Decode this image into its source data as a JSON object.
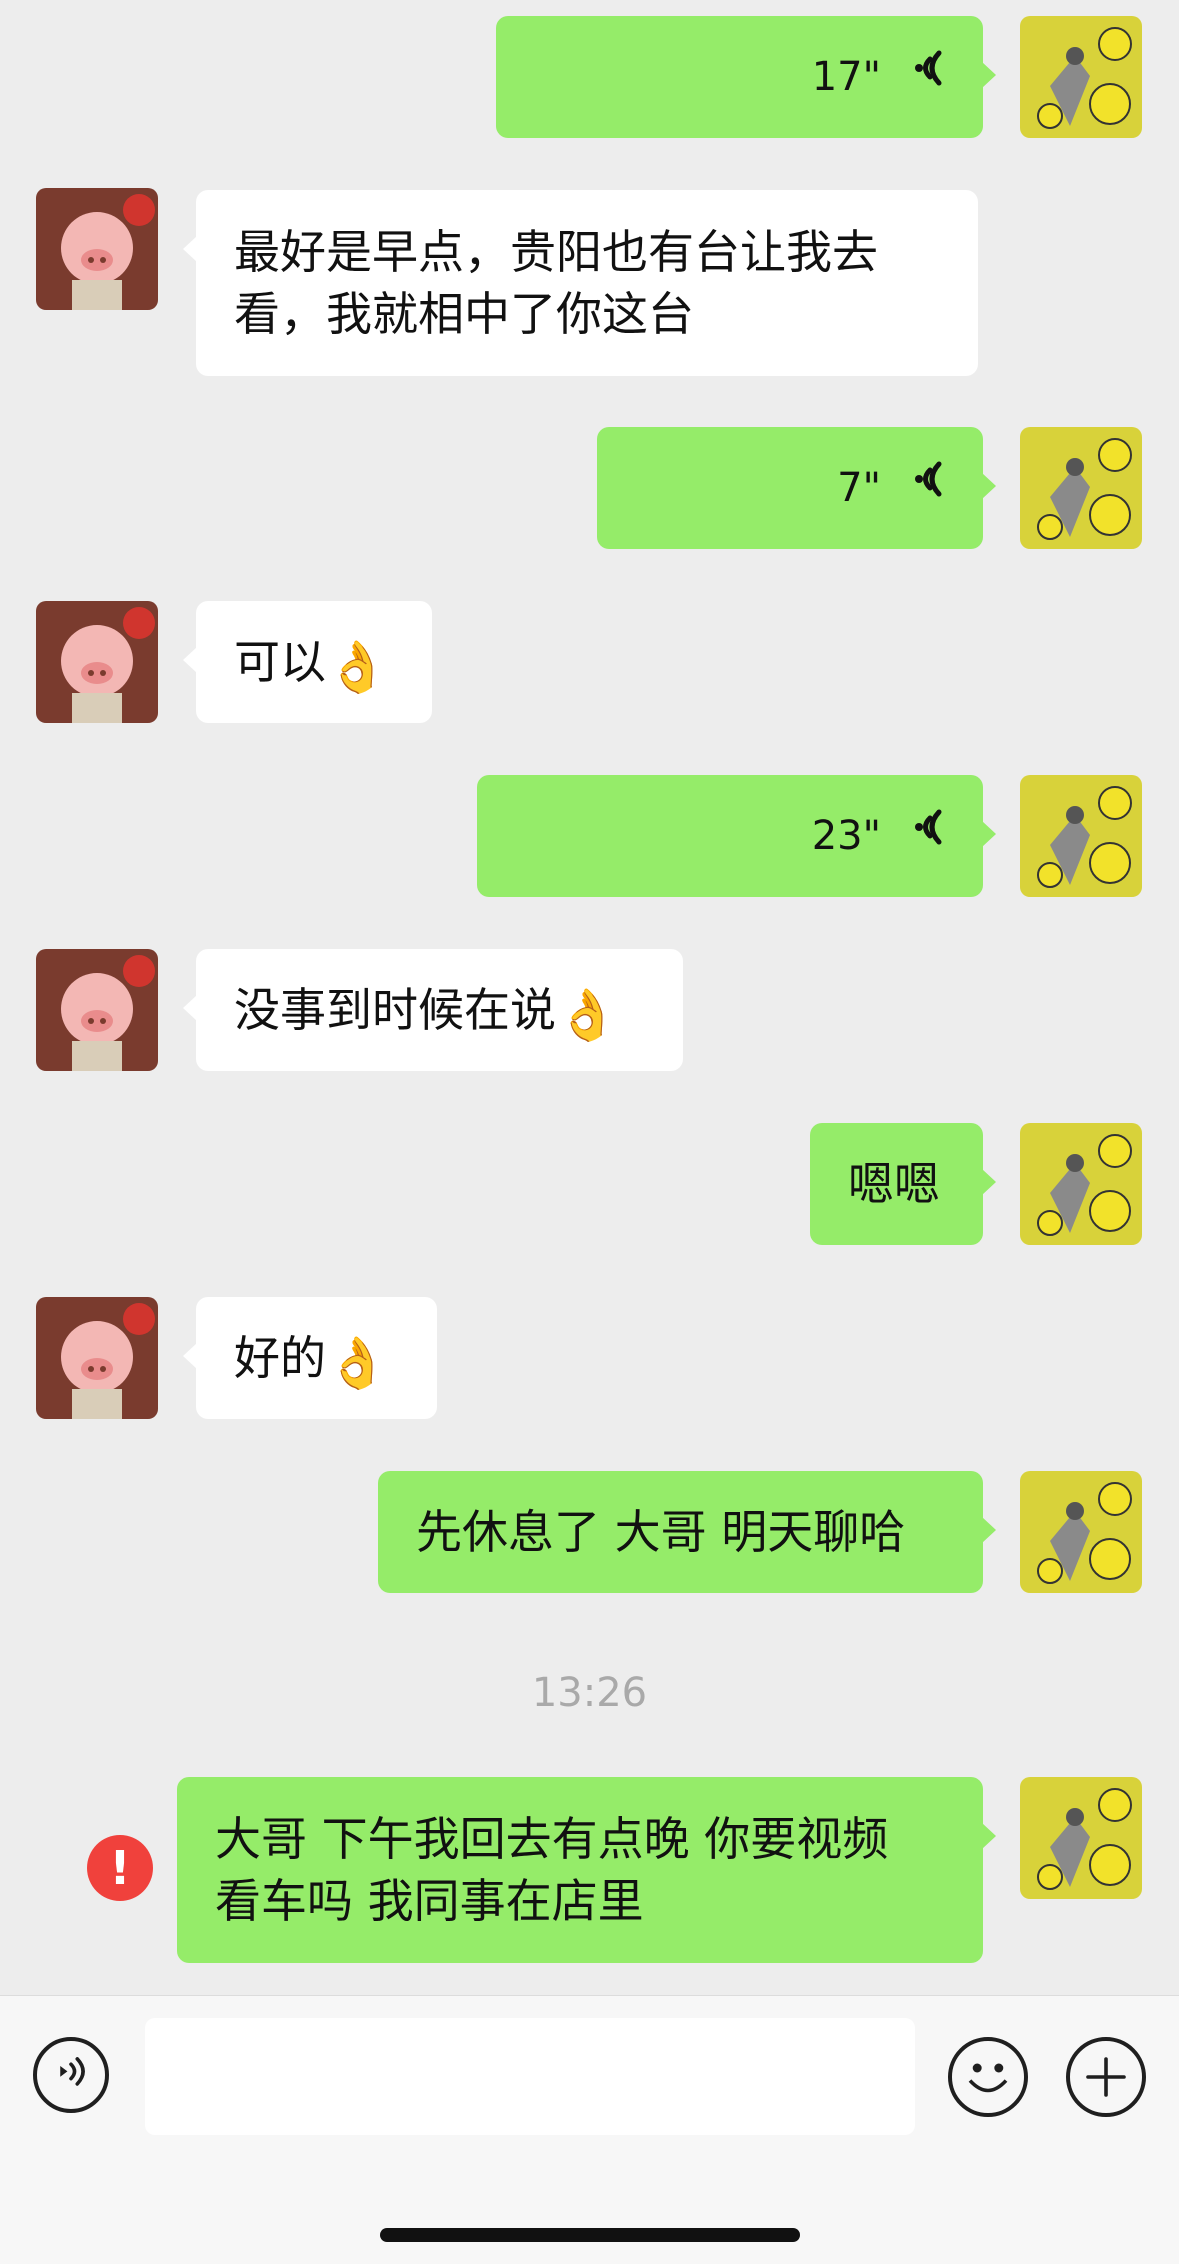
{
  "messages": [
    {
      "id": "m1",
      "from": "me",
      "type": "voice",
      "duration": "17\""
    },
    {
      "id": "m2",
      "from": "them",
      "type": "text",
      "lines": [
        "最好是早点，贵阳也有台让我去",
        "看，我就相中了你这台"
      ]
    },
    {
      "id": "m3",
      "from": "me",
      "type": "voice",
      "duration": "7\""
    },
    {
      "id": "m4",
      "from": "them",
      "type": "text",
      "text": "可以",
      "emoji": "👌"
    },
    {
      "id": "m5",
      "from": "me",
      "type": "voice",
      "duration": "23\""
    },
    {
      "id": "m6",
      "from": "them",
      "type": "text",
      "text": "没事到时候在说",
      "emoji": "👌"
    },
    {
      "id": "m7",
      "from": "me",
      "type": "text",
      "text": "嗯嗯"
    },
    {
      "id": "m8",
      "from": "them",
      "type": "text",
      "text": "好的",
      "emoji": "👌"
    },
    {
      "id": "m9",
      "from": "me",
      "type": "text",
      "text": "先休息了 大哥 明天聊哈"
    },
    {
      "id": "m10",
      "from": "me",
      "type": "text",
      "lines": [
        "大哥 下午我回去有点晚 你要视频",
        "看车吗 我同事在店里"
      ],
      "failed": true
    }
  ],
  "timestamp": "13:26",
  "error_mark": "!",
  "input": {
    "value": "",
    "placeholder": ""
  },
  "colors": {
    "my_bubble": "#95ec69",
    "their_bubble": "#ffffff",
    "background": "#ededed",
    "error": "#f0413c"
  },
  "icons": {
    "voice_toggle": "voice-icon",
    "emoji": "smiley-icon",
    "more": "plus-icon",
    "voice_msg": "sound-wave-icon"
  }
}
